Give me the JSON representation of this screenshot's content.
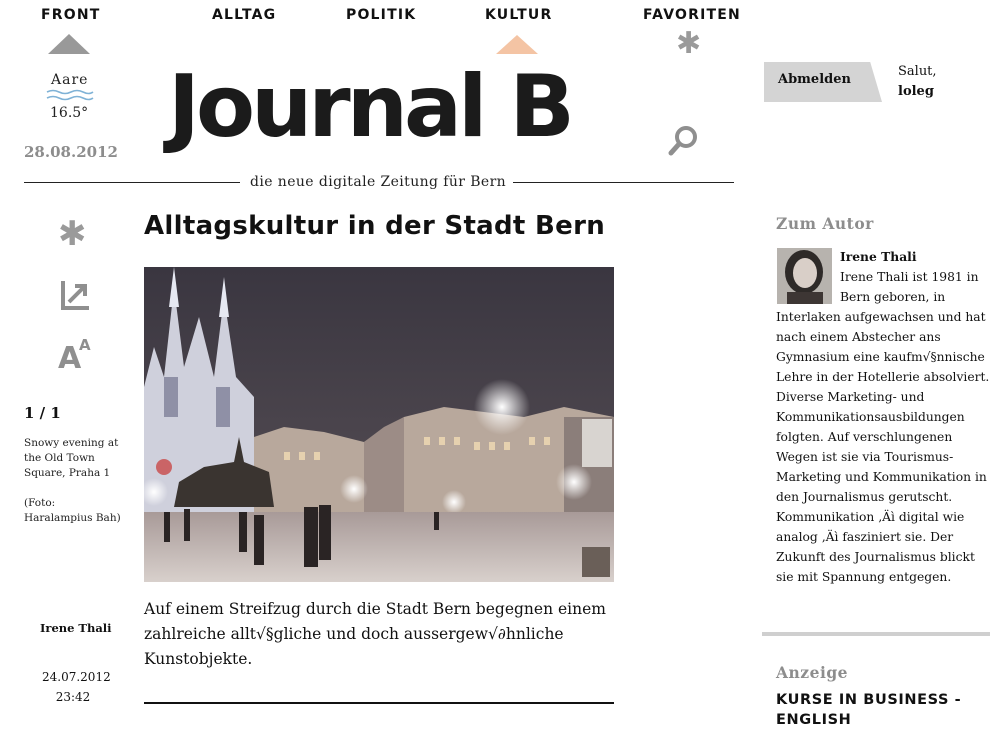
{
  "nav": {
    "front": "FRONT",
    "alltag": "ALLTAG",
    "politik": "POLITIK",
    "kultur": "KULTUR",
    "favoriten": "FAVORITEN"
  },
  "weather": {
    "location": "Aare",
    "temperature": "16.5°"
  },
  "date": "28.08.2012",
  "logo": "Journal B",
  "tagline": "die neue digitale Zeitung für Bern",
  "account": {
    "logout_label": "Abmelden",
    "greeting": "Salut,",
    "username": "loleg"
  },
  "article": {
    "headline": "Alltagskultur in der Stadt Bern",
    "lead": "Auf einem Streifzug durch die Stadt Bern begegnen einem zahlreiche allt√§gliche und doch aussergew√∂hnliche Kunstobjekte.",
    "author": "Irene Thali",
    "date": "24.07.2012",
    "time": "23:42"
  },
  "gallery": {
    "count": "1 / 1",
    "caption": "Snowy evening at the Old Town Square, Praha 1",
    "credit": "(Foto: Haralampius Bah)"
  },
  "sidebar": {
    "author_heading": "Zum Autor",
    "author_name": "Irene Thali",
    "author_bio": "Irene Thali ist 1981 in Bern geboren, in Interlaken aufgewachsen und hat nach einem Abstecher ans Gymnasium eine kaufm√§nnische Lehre in der Hotellerie absolviert. Diverse Marketing- und Kommunikationsausbildungen folgten. Auf verschlungenen Wegen ist sie via Tourismus-Marketing und Kommunikation in den Journalismus gerutscht. Kommunikation ‚Äì digital wie analog ‚Äì fasziniert sie. Der Zukunft des Journalismus blickt sie mit Spannung entgegen.",
    "ad_heading": "Anzeige",
    "ad_title": "KURSE IN BUSINESS - ENGLISH"
  },
  "colors": {
    "kultur_accent": "#f4c4a4",
    "front_indicator": "#999999",
    "muted_text": "#8d8d8d"
  }
}
